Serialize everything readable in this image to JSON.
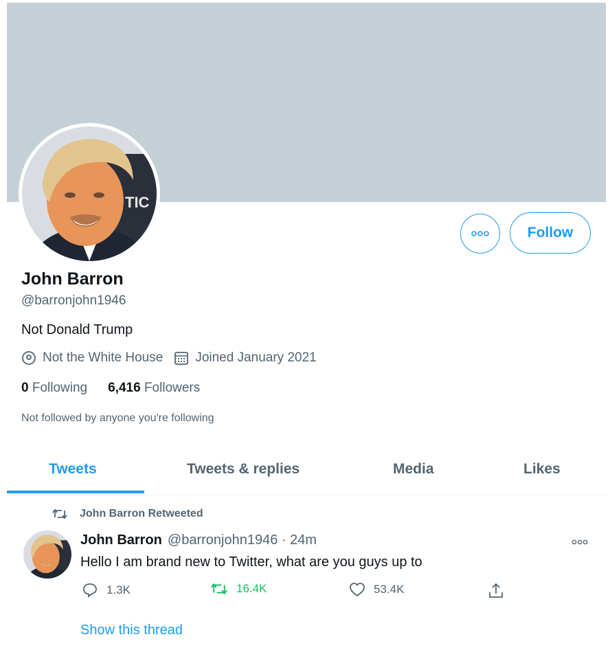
{
  "profile": {
    "name": "John Barron",
    "handle": "@barronjohn1946",
    "bio": "Not Donald Trump",
    "location": "Not the White House",
    "joined": "Joined January 2021",
    "following_count": "0",
    "following_label": "Following",
    "followers_count": "6,416",
    "followers_label": "Followers",
    "followed_note": "Not followed by anyone you're following"
  },
  "buttons": {
    "follow_label": "Follow"
  },
  "tabs": [
    {
      "label": "Tweets",
      "active": true
    },
    {
      "label": "Tweets & replies",
      "active": false
    },
    {
      "label": "Media",
      "active": false
    },
    {
      "label": "Likes",
      "active": false
    }
  ],
  "tweet": {
    "retweet_context": "John Barron Retweeted",
    "author_name": "John Barron",
    "author_handle": "@barronjohn1946",
    "separator": "·",
    "time": "24m",
    "text": "Hello I am brand new to Twitter, what are you guys up to",
    "replies": "1.3K",
    "retweets": "16.4K",
    "likes": "53.4K",
    "show_thread": "Show this thread"
  },
  "colors": {
    "accent": "#1d9bf0",
    "banner": "#c4cfd6",
    "retweet_green": "#17bf63",
    "secondary_text": "#536471"
  },
  "icons": [
    "more-icon",
    "location-icon",
    "calendar-icon",
    "retweet-icon",
    "reply-icon",
    "like-icon",
    "share-icon"
  ]
}
